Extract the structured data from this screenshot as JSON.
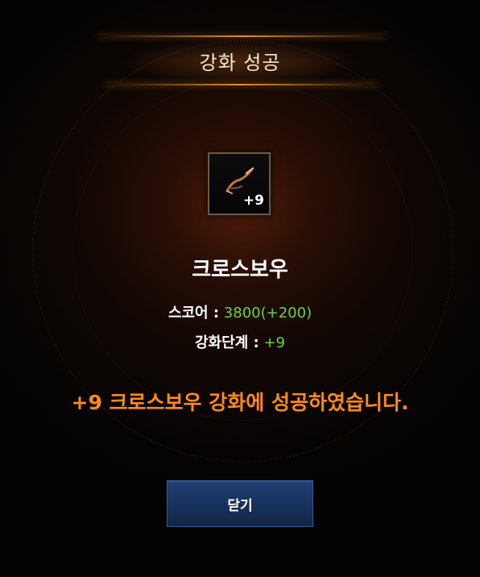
{
  "dialog": {
    "title": "강화 성공"
  },
  "item": {
    "icon": "crossbow-icon",
    "level_badge": "+9",
    "name": "크로스보우"
  },
  "stats": {
    "score_label": "스코어 :",
    "score_value": "3800(+200)",
    "level_label": "강화단계 :",
    "level_value": "+9"
  },
  "message": "+9 크로스보우 강화에 성공하였습니다.",
  "buttons": {
    "close_label": "닫기"
  },
  "colors": {
    "accent_orange": "#ff8a1c",
    "value_green": "#6cd43a",
    "button_blue": "#1f3e74",
    "title_text": "#f1e7d3"
  }
}
